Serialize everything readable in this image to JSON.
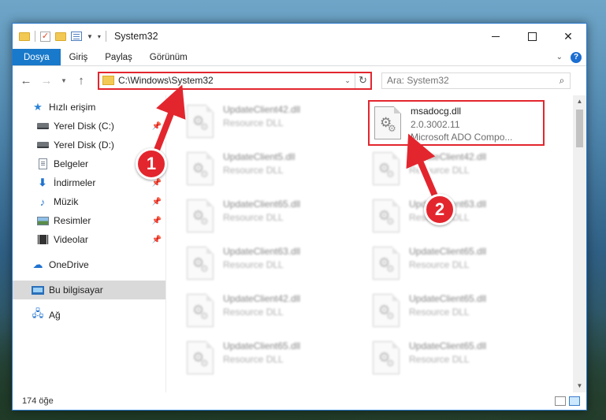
{
  "window": {
    "title": "System32",
    "controls": {
      "minimize": "",
      "maximize": "",
      "close": "✕"
    }
  },
  "ribbon": {
    "tabs": [
      "Dosya",
      "Giriş",
      "Paylaş",
      "Görünüm"
    ],
    "help": "?"
  },
  "address": {
    "path": "C:\\Windows\\System32",
    "search_placeholder": "Ara: System32"
  },
  "nav": {
    "quick_access": "Hızlı erişim",
    "items": [
      {
        "label": "Yerel Disk (C:)",
        "icon": "drive-icon",
        "pinned": true
      },
      {
        "label": "Yerel Disk (D:)",
        "icon": "drive-icon",
        "pinned": false
      },
      {
        "label": "Belgeler",
        "icon": "documents-icon",
        "pinned": false
      },
      {
        "label": "İndirmeler",
        "icon": "downloads-icon",
        "pinned": true
      },
      {
        "label": "Müzik",
        "icon": "music-icon",
        "pinned": true
      },
      {
        "label": "Resimler",
        "icon": "pictures-icon",
        "pinned": true
      },
      {
        "label": "Videolar",
        "icon": "videos-icon",
        "pinned": true
      }
    ],
    "onedrive": "OneDrive",
    "this_pc": "Bu bilgisayar",
    "network": "Ağ"
  },
  "files": {
    "left": [
      {
        "name": "UpdateClient42.dll",
        "sub": "Resource DLL"
      },
      {
        "name": "UpdateClient5.dll",
        "sub": "Resource DLL"
      },
      {
        "name": "UpdateClient65.dll",
        "sub": "Resource DLL"
      },
      {
        "name": "UpdateClient63.dll",
        "sub": "Resource DLL"
      },
      {
        "name": "UpdateClient42.dll",
        "sub": "Resource DLL"
      },
      {
        "name": "UpdateClient65.dll",
        "sub": "Resource DLL"
      }
    ],
    "right": [
      {
        "name": "msadocg.dll",
        "sub": "2.0.3002.11",
        "sub2": "Microsoft ADO Compo..."
      },
      {
        "name": "UpdateClient42.dll",
        "sub": "Resource DLL"
      },
      {
        "name": "UpdateClient63.dll",
        "sub": "Resource DLL"
      },
      {
        "name": "UpdateClient65.dll",
        "sub": "Resource DLL"
      },
      {
        "name": "UpdateClient65.dll",
        "sub": "Resource DLL"
      },
      {
        "name": "UpdateClient65.dll",
        "sub": "Resource DLL"
      }
    ]
  },
  "status": {
    "count": "174 öğe"
  },
  "annotations": {
    "badge1": "1",
    "badge2": "2",
    "color": "#e3262e"
  }
}
